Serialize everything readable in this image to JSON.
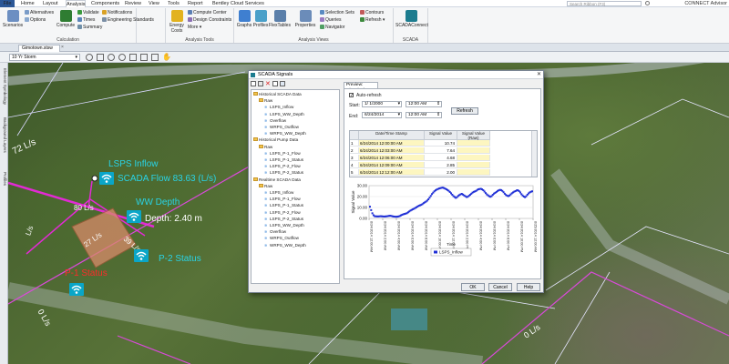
{
  "menu": {
    "tabs": [
      "File",
      "Home",
      "Layout",
      "Analysis",
      "Components",
      "Review",
      "View",
      "Tools",
      "Report",
      "Bentley Cloud Services"
    ],
    "search_placeholder": "Search Ribbon (F3)",
    "signin": "CONNECT Advisor"
  },
  "ribbon": {
    "calculation": {
      "label": "Calculation",
      "scenarios": "Scenarios",
      "alternatives": "Alternatives",
      "options": "Options",
      "compute": "Compute",
      "validate": "Validate",
      "times": "Times",
      "summary": "Summary",
      "notifications": "Notifications",
      "engineering_standards": "Engineering Standards"
    },
    "analysis_tools": {
      "label": "Analysis Tools",
      "energy_costs": "Energy Costs",
      "compute_center": "Compute Center",
      "design_constraints": "Design Constraints",
      "more": "More"
    },
    "analysis_views": {
      "label": "Analysis Views",
      "graphs": "Graphs",
      "profiles": "Profiles",
      "flextables": "FlexTables",
      "properties": "Properties",
      "selection_sets": "Selection Sets",
      "queries": "Queries",
      "navigator": "Navigator",
      "contours": "Contours",
      "refresh": "Refresh"
    },
    "scada": {
      "label": "SCADA",
      "scadaconnect": "SCADAConnect"
    }
  },
  "document": {
    "tab": "Gimotown.stsw",
    "scenario": "10 Yr Storm"
  },
  "dock": [
    "Element Symbology",
    "Background Layers",
    "Profiles"
  ],
  "map_labels": {
    "flow_72": "72 L/s",
    "flow_80": "80 L/s",
    "flow_27": "27 L/s",
    "flow_39": "39 L/s",
    "flow_0a": "0 L/s",
    "flow_0b": "0 L/s",
    "flow_l": "L/s",
    "lsps_inflow": "LSPS Inflow",
    "scada_flow": "SCADA Flow 83.63 (L/s)",
    "ww_depth": "WW Depth",
    "depth": "Depth: 2.40 m",
    "p2_status": "P-2 Status",
    "p1_status": "P-1 Status"
  },
  "dialog": {
    "title": "SCADA Signals",
    "preview_tab": "Preview: Historical",
    "auto_refresh": "Auto-refresh",
    "start_label": "Start:",
    "start_date": "1/ 1/2000",
    "start_time": "12:00 AM",
    "end_label": "End:",
    "end_date": "6/24/2014",
    "end_time": "12:00 AM",
    "refresh": "Refresh",
    "ok": "OK",
    "cancel": "Cancel",
    "help": "Help",
    "tree": [
      {
        "label": "Historical SCADA Data",
        "level": 0,
        "kind": "folder"
      },
      {
        "label": "Raw",
        "level": 1,
        "kind": "folder"
      },
      {
        "label": "LSPS_Inflow",
        "level": 2,
        "kind": "signal"
      },
      {
        "label": "LSPS_WW_Depth",
        "level": 2,
        "kind": "signal"
      },
      {
        "label": "Overflow",
        "level": 2,
        "kind": "signal"
      },
      {
        "label": "WRPS_Outflow",
        "level": 2,
        "kind": "signal"
      },
      {
        "label": "WRPS_WW_Depth",
        "level": 2,
        "kind": "signal"
      },
      {
        "label": "Historical Pump Data",
        "level": 0,
        "kind": "folder"
      },
      {
        "label": "Raw",
        "level": 1,
        "kind": "folder"
      },
      {
        "label": "LSPS_P-1_Flow",
        "level": 2,
        "kind": "signal"
      },
      {
        "label": "LSPS_P-1_Status",
        "level": 2,
        "kind": "signal"
      },
      {
        "label": "LSPS_P-2_Flow",
        "level": 2,
        "kind": "signal"
      },
      {
        "label": "LSPS_P-2_Status",
        "level": 2,
        "kind": "signal"
      },
      {
        "label": "Realtime SCADA Data",
        "level": 0,
        "kind": "folder"
      },
      {
        "label": "Raw",
        "level": 1,
        "kind": "folder"
      },
      {
        "label": "LSPS_Inflow",
        "level": 2,
        "kind": "signal"
      },
      {
        "label": "LSPS_P-1_Flow",
        "level": 2,
        "kind": "signal"
      },
      {
        "label": "LSPS_P-1_Status",
        "level": 2,
        "kind": "signal"
      },
      {
        "label": "LSPS_P-2_Flow",
        "level": 2,
        "kind": "signal"
      },
      {
        "label": "LSPS_P-2_Status",
        "level": 2,
        "kind": "signal"
      },
      {
        "label": "LSPS_WW_Depth",
        "level": 2,
        "kind": "signal"
      },
      {
        "label": "Overflow",
        "level": 2,
        "kind": "signal"
      },
      {
        "label": "WRPS_Outflow",
        "level": 2,
        "kind": "signal"
      },
      {
        "label": "WRPS_WW_Depth",
        "level": 2,
        "kind": "signal"
      }
    ],
    "grid": {
      "headers": [
        "",
        "Date/Time Stamp",
        "Signal Value",
        "Signal Value (Raw)"
      ],
      "rows": [
        [
          "1",
          "6/24/2014 12:00:00 AM",
          "10.74"
        ],
        [
          "2",
          "6/24/2014 12:03:00 AM",
          "7.64"
        ],
        [
          "3",
          "6/24/2014 12:06:00 AM",
          "4.68"
        ],
        [
          "4",
          "6/24/2014 12:09:00 AM",
          "2.85"
        ],
        [
          "5",
          "6/24/2014 12:12:00 AM",
          "2.00"
        ]
      ]
    }
  },
  "chart_data": {
    "type": "scatter",
    "ylabel": "Signal Value",
    "xlabel": "Time",
    "ylim": [
      0,
      30
    ],
    "yticks": [
      "0.00",
      "10.00",
      "20.00",
      "30.00"
    ],
    "xticks": [
      "6/24/2014 12:00 AM",
      "6/24/2014 2:00 AM",
      "6/24/2014 4:00 AM",
      "6/24/2014 6:00 AM",
      "6/24/2014 8:00 AM",
      "6/24/2014 10:00 AM",
      "6/24/2014 12:00 PM",
      "6/24/2014 2:00 PM",
      "6/24/2014 4:00 PM",
      "6/24/2014 6:00 PM",
      "6/24/2014 8:00 PM",
      "6/24/2014 10:00 PM",
      "6/25/2014 12:00 AM"
    ],
    "legend": "LSPS_Inflow",
    "color": "#1f2fd6",
    "series": [
      {
        "name": "LSPS_Inflow",
        "values": [
          10.7,
          7.6,
          4.7,
          2.9,
          2.0,
          1.9,
          1.8,
          1.8,
          1.9,
          2.0,
          1.9,
          1.8,
          1.7,
          1.8,
          1.9,
          2.1,
          2.3,
          2.4,
          2.2,
          1.9,
          1.7,
          1.6,
          1.5,
          1.6,
          1.8,
          2.2,
          2.8,
          3.3,
          3.8,
          4.1,
          4.4,
          4.8,
          5.6,
          6.4,
          7.2,
          7.8,
          8.4,
          8.9,
          9.6,
          10.2,
          10.9,
          11.6,
          12.0,
          12.4,
          13.1,
          14.0,
          14.7,
          15.4,
          16.3,
          17.5,
          19.0,
          20.6,
          22.3,
          23.6,
          24.8,
          25.7,
          26.4,
          26.9,
          27.4,
          27.7,
          28.0,
          28.2,
          27.8,
          27.3,
          26.7,
          26.0,
          25.3,
          24.2,
          23.0,
          21.7,
          20.4,
          19.6,
          18.8,
          19.5,
          20.6,
          21.4,
          22.0,
          22.5,
          21.8,
          21.0,
          20.3,
          19.6,
          19.8,
          20.7,
          21.6,
          22.6,
          23.6,
          24.3,
          24.7,
          25.2,
          26.1,
          26.7,
          26.9,
          27.1,
          26.6,
          25.8,
          24.6,
          23.2,
          22.0,
          21.1,
          20.3,
          19.8,
          20.4,
          21.6,
          22.7,
          23.4,
          24.2,
          25.1,
          25.7,
          26.1,
          25.9,
          25.2,
          24.0,
          22.6,
          21.5,
          20.8,
          20.4,
          21.0,
          22.0,
          23.0,
          23.8,
          24.5,
          25.0,
          25.6,
          25.8,
          25.0,
          23.8,
          22.2,
          21.0,
          20.0,
          19.4,
          20.3,
          21.7,
          22.9,
          23.8,
          24.4,
          24.8
        ]
      }
    ]
  }
}
